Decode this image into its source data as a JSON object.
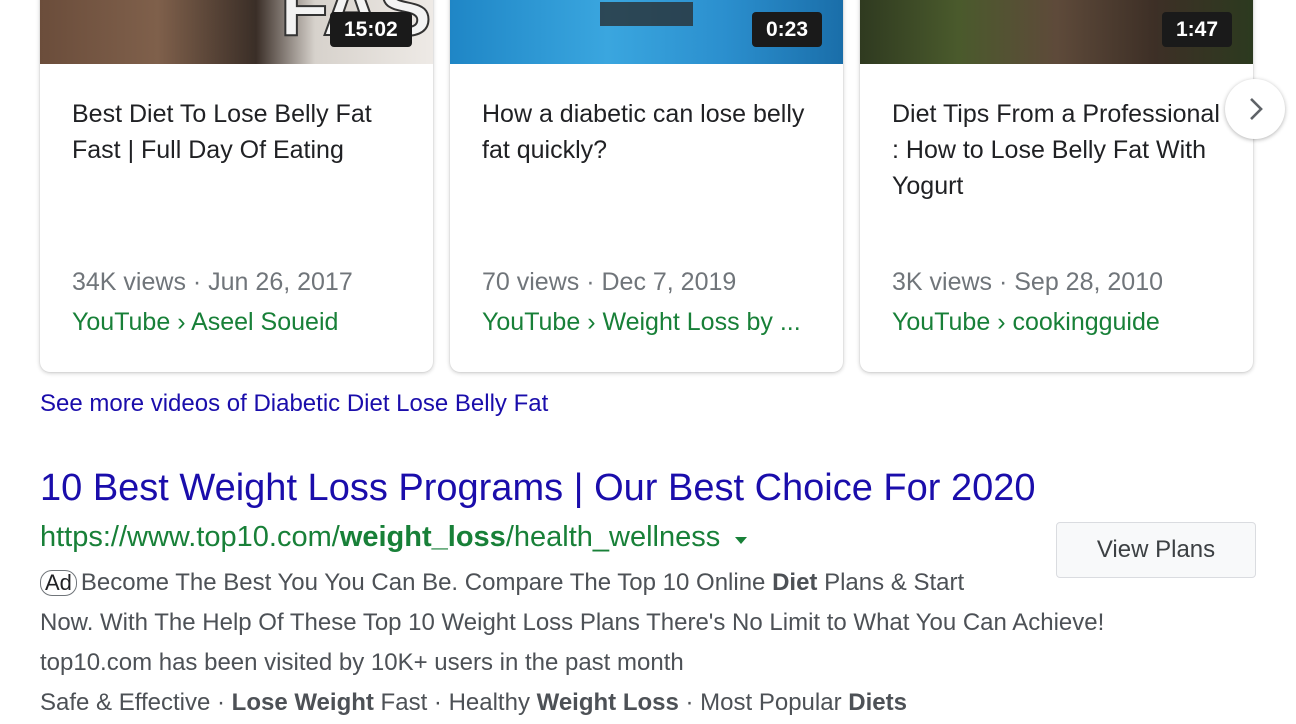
{
  "videos": [
    {
      "thumb_text": "FAST",
      "duration": "15:02",
      "title": "Best Diet To Lose Belly Fat Fast | Full Day Of Eating",
      "meta": "34K views · Jun 26, 2017",
      "source": "YouTube › Aseel Soueid"
    },
    {
      "duration": "0:23",
      "title": "How a diabetic can lose belly fat quickly?",
      "meta": "70 views · Dec 7, 2019",
      "source": "YouTube › Weight Loss by ..."
    },
    {
      "duration": "1:47",
      "title": "Diet Tips From a Professional : How to Lose Belly Fat With Yogurt",
      "meta": "3K views · Sep 28, 2010",
      "source": "YouTube › cookingguide"
    }
  ],
  "carousel": {
    "next_icon": "chevron-right-icon"
  },
  "see_more": "See more videos of Diabetic Diet Lose Belly Fat",
  "ad": {
    "title": "10 Best Weight Loss Programs | Our Best Choice For 2020",
    "url_prefix": "https://www.top10.com/",
    "url_bold": "weight_loss",
    "url_suffix": "/health_wellness",
    "dropdown_icon": "caret-down-icon",
    "view_button": "View Plans",
    "badge": "Ad",
    "line1_a": "Become The Best You You Can Be. Compare The Top 10 Online ",
    "line1_bold": "Diet",
    "line1_b": " Plans & Start",
    "line2": "Now. With The Help Of These Top 10 Weight Loss Plans There's No Limit to What You Can Achieve!",
    "visited": "top10.com has been visited by 10K+ users in the past month",
    "sitelinks": {
      "s1": "Safe & Effective · ",
      "s2_bold": "Lose Weight",
      "s2": " Fast · Healthy ",
      "s3_bold": "Weight Loss",
      "s3": " · Most Popular ",
      "s4_bold": "Diets"
    }
  },
  "colors": {
    "link_blue": "#1a0dab",
    "url_green": "#188038",
    "meta_gray": "#70757a",
    "text_dark": "#202124"
  }
}
